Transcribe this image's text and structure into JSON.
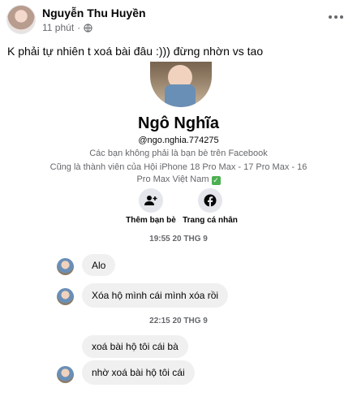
{
  "post": {
    "author": "Nguyễn Thu Huyền",
    "time": "11 phút",
    "separator": "·",
    "text": "K phải tự nhiên t xoá bài đâu :))) đừng nhờn vs tao"
  },
  "profile": {
    "name": "Ngô Nghĩa",
    "handle": "@ngo.nghia.774275",
    "not_friends": "Các bạn không phải là bạn bè trên Facebook",
    "group_member": "Cũng là thành viên của Hội iPhone 18 Pro Max - 17 Pro Max - 16 Pro Max Việt Nam",
    "actions": [
      {
        "label": "Thêm bạn bè",
        "icon": "add-friend-icon"
      },
      {
        "label": "Trang cá nhân",
        "icon": "facebook-icon"
      }
    ]
  },
  "messages": {
    "divider_1": "19:55 20 THG 9",
    "divider_2": "22:15 20 THG 9",
    "items": [
      {
        "text": "Alo"
      },
      {
        "text": "Xóa hộ mình cái mình xóa rồi"
      },
      {
        "text": "xoá bài hộ tôi cái bà"
      },
      {
        "text": "nhờ xoá bài hộ tôi cái"
      }
    ]
  },
  "colors": {
    "text_primary": "#050505",
    "text_secondary": "#65676b",
    "bubble": "#f0f0f0",
    "check": "#4caf50"
  }
}
